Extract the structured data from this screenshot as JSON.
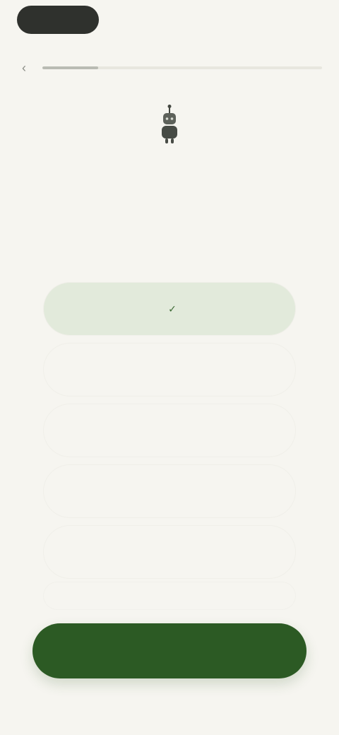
{
  "header": {
    "brand_label": "",
    "back_icon": "back-arrow-icon",
    "progress": 0.2
  },
  "hero": {
    "icon": "robot-icon",
    "step_label": "",
    "question": ""
  },
  "options": {
    "item_0": "",
    "item_1": "",
    "item_2": "",
    "item_3": "",
    "item_4": "",
    "item_5": ""
  },
  "footer": {
    "continue_label": ""
  },
  "colors": {
    "background": "#f6f5f0",
    "accent": "#2c5a24",
    "selected_option": "#e2eadb"
  }
}
